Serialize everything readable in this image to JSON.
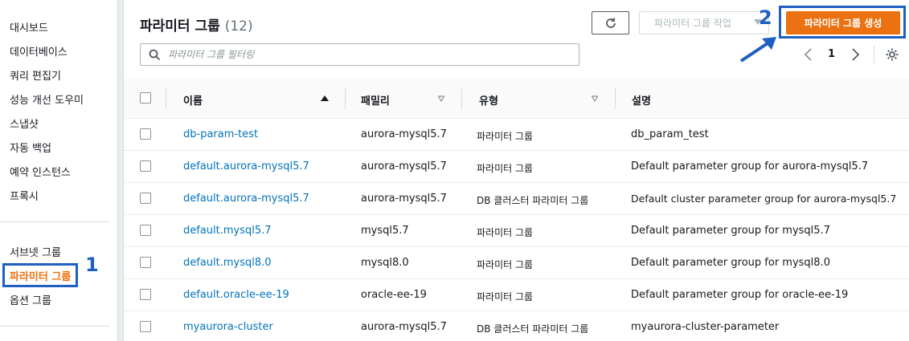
{
  "sidebar": {
    "items": [
      {
        "label": "대시보드"
      },
      {
        "label": "데이터베이스"
      },
      {
        "label": "쿼리 편집기"
      },
      {
        "label": "성능 개선 도우미"
      },
      {
        "label": "스냅샷"
      },
      {
        "label": "자동 백업"
      },
      {
        "label": "예약 인스턴스"
      },
      {
        "label": "프록시"
      }
    ],
    "items2": [
      {
        "label": "서브넷 그룹"
      },
      {
        "label": "파라미터 그룹"
      },
      {
        "label": "옵션 그룹"
      }
    ],
    "active_index": 1
  },
  "annotations": {
    "step1": "1",
    "step2": "2"
  },
  "header": {
    "title": "파라미터 그룹",
    "count": "(12)",
    "actions_label": "파라미터 그룹 작업",
    "create_label": "파라미터 그룹 생성"
  },
  "search": {
    "placeholder": "파라미터 그룹 필터링"
  },
  "pagination": {
    "current_page": "1"
  },
  "table": {
    "columns": [
      "이름",
      "패밀리",
      "유형",
      "설명"
    ],
    "rows": [
      {
        "name": "db-param-test",
        "family": "aurora-mysql5.7",
        "type": "파라미터 그룹",
        "description": "db_param_test"
      },
      {
        "name": "default.aurora-mysql5.7",
        "family": "aurora-mysql5.7",
        "type": "파라미터 그룹",
        "description": "Default parameter group for aurora-mysql5.7"
      },
      {
        "name": "default.aurora-mysql5.7",
        "family": "aurora-mysql5.7",
        "type": "DB 클러스터 파라미터 그룹",
        "description": "Default cluster parameter group for aurora-mysql5.7"
      },
      {
        "name": "default.mysql5.7",
        "family": "mysql5.7",
        "type": "파라미터 그룹",
        "description": "Default parameter group for mysql5.7"
      },
      {
        "name": "default.mysql8.0",
        "family": "mysql8.0",
        "type": "파라미터 그룹",
        "description": "Default parameter group for mysql8.0"
      },
      {
        "name": "default.oracle-ee-19",
        "family": "oracle-ee-19",
        "type": "파라미터 그룹",
        "description": "Default parameter group for oracle-ee-19"
      },
      {
        "name": "myaurora-cluster",
        "family": "aurora-mysql5.7",
        "type": "DB 클러스터 파라미터 그룹",
        "description": "myaurora-cluster-parameter"
      }
    ]
  },
  "colors": {
    "accent": "#ec7211",
    "link": "#0073bb",
    "annotation": "#1f5fbf"
  }
}
